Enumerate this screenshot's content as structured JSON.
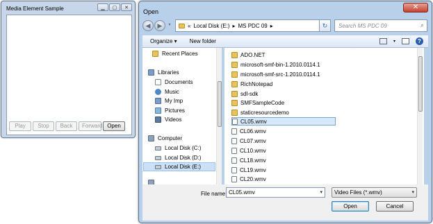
{
  "media_window": {
    "title": "Media Element Sample",
    "buttons": [
      {
        "label": "Play",
        "enabled": false
      },
      {
        "label": "Stop",
        "enabled": false
      },
      {
        "label": "Back",
        "enabled": false
      },
      {
        "label": "Forward",
        "enabled": false
      },
      {
        "label": "Open",
        "enabled": true
      }
    ]
  },
  "open_dialog": {
    "title": "Open",
    "breadcrumb": [
      "«",
      "Local Disk (E:)",
      "MS PDC 09"
    ],
    "search_placeholder": "Search MS PDC 09",
    "toolbar": {
      "organize": "Organize ▾",
      "new_folder": "New folder"
    },
    "nav_items": [
      {
        "label": "Recent Places",
        "icon": "recent-places-icon"
      },
      {
        "label": "Libraries",
        "icon": "libraries-icon"
      },
      {
        "label": "Documents",
        "icon": "documents-icon"
      },
      {
        "label": "Music",
        "icon": "music-icon"
      },
      {
        "label": "My Imp",
        "icon": "library-icon"
      },
      {
        "label": "Pictures",
        "icon": "pictures-icon"
      },
      {
        "label": "Videos",
        "icon": "videos-icon"
      },
      {
        "label": "Computer",
        "icon": "computer-icon"
      },
      {
        "label": "Local Disk (C:)",
        "icon": "disk-icon"
      },
      {
        "label": "Local Disk (D:)",
        "icon": "disk-icon"
      },
      {
        "label": "Local Disk (E:)",
        "icon": "disk-icon",
        "selected": true
      }
    ],
    "files": [
      {
        "name": "ADO.NET",
        "kind": "folder"
      },
      {
        "name": "microsoft-smf-bin-1.2010.0114.1",
        "kind": "folder"
      },
      {
        "name": "microsoft-smf-src-1.2010.0114.1",
        "kind": "folder"
      },
      {
        "name": "RichNotepad",
        "kind": "folder"
      },
      {
        "name": "sdl-sdk",
        "kind": "folder"
      },
      {
        "name": "SMFSampleCode",
        "kind": "folder"
      },
      {
        "name": "staticresourcedemo",
        "kind": "folder"
      },
      {
        "name": "CL05.wmv",
        "kind": "wmv",
        "selected": true
      },
      {
        "name": "CL06.wmv",
        "kind": "wmv"
      },
      {
        "name": "CL07.wmv",
        "kind": "wmv"
      },
      {
        "name": "CL10.wmv",
        "kind": "wmv"
      },
      {
        "name": "CL18.wmv",
        "kind": "wmv"
      },
      {
        "name": "CL19.wmv",
        "kind": "wmv"
      },
      {
        "name": "CL20.wmv",
        "kind": "wmv"
      }
    ],
    "file_name_label": "File name:",
    "file_name_value": "CL05.wmv",
    "file_type_value": "Video Files (*.wmv)",
    "open_label": "Open",
    "cancel_label": "Cancel"
  },
  "colors": {
    "frame": "#b9d0ea",
    "selection": "#cce0f7",
    "close_button": "#c6422f"
  }
}
